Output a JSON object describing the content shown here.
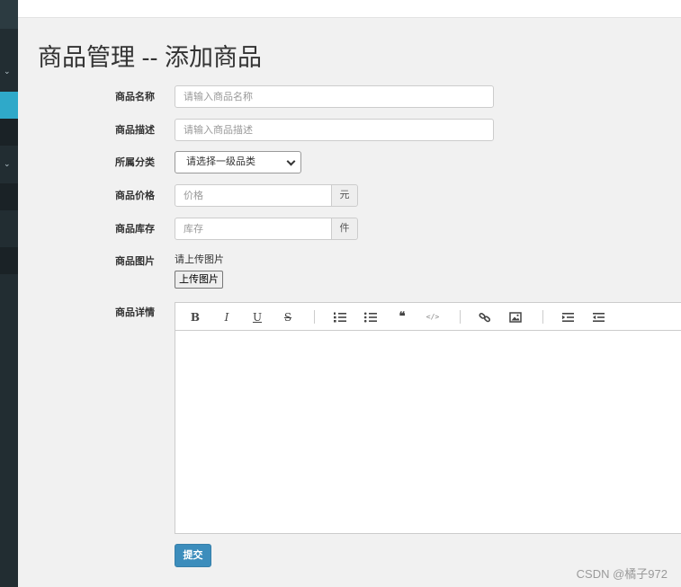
{
  "page": {
    "title": "商品管理 -- 添加商品"
  },
  "form": {
    "name": {
      "label": "商品名称",
      "placeholder": "请输入商品名称"
    },
    "desc": {
      "label": "商品描述",
      "placeholder": "请输入商品描述"
    },
    "category": {
      "label": "所属分类",
      "selected": "请选择一级品类"
    },
    "price": {
      "label": "商品价格",
      "placeholder": "价格",
      "unit": "元"
    },
    "stock": {
      "label": "商品库存",
      "placeholder": "库存",
      "unit": "件"
    },
    "image": {
      "label": "商品图片",
      "note": "请上传图片",
      "button": "上传图片"
    },
    "detail": {
      "label": "商品详情"
    },
    "submit": "提交"
  },
  "editor": {
    "toolbar_icons": [
      "bold-icon",
      "italic-icon",
      "underline-icon",
      "strikethrough-icon",
      "ordered-list-icon",
      "unordered-list-icon",
      "blockquote-icon",
      "code-icon",
      "link-icon",
      "image-icon",
      "indent-icon",
      "outdent-icon"
    ],
    "glyphs": {
      "bold": "B",
      "italic": "I",
      "underline": "U",
      "strike": "S",
      "quote": "❝",
      "code": "</>"
    }
  },
  "watermark": "CSDN @橘子972",
  "colors": {
    "sidebar": "#222d32",
    "sidebar_active": "#2fa9c9",
    "primary": "#3c8dbc",
    "background": "#f1f1f1"
  }
}
